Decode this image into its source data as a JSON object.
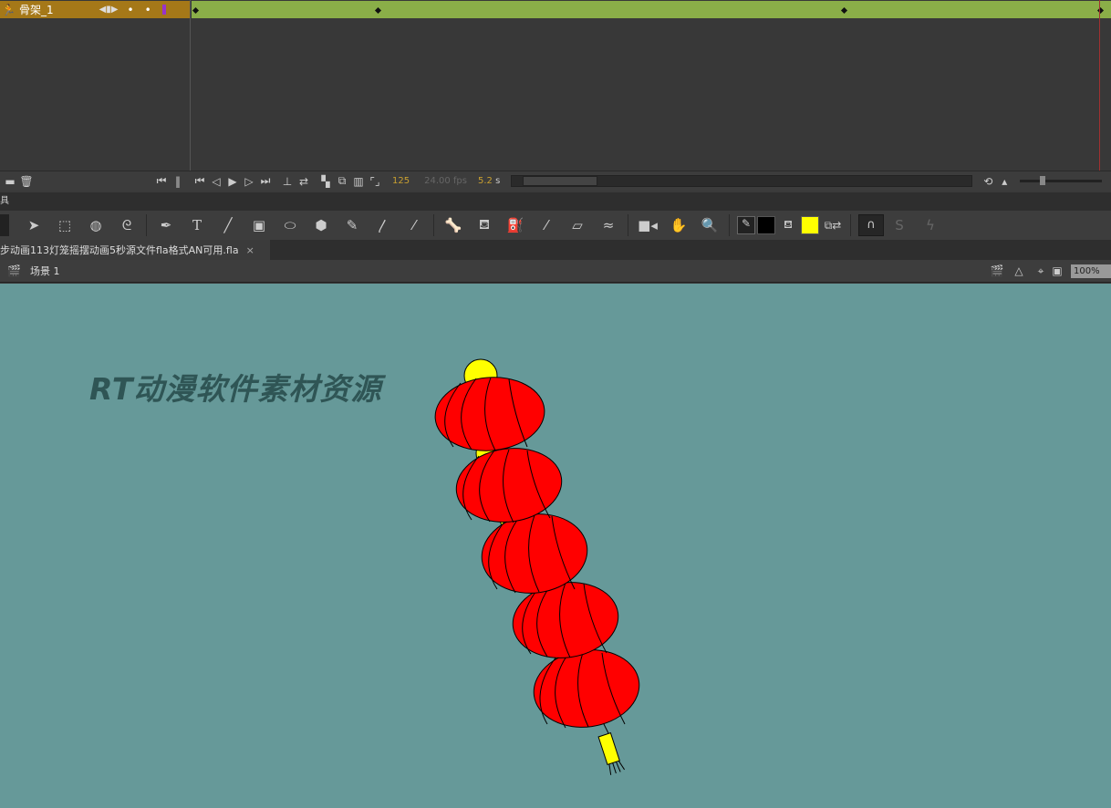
{
  "timeline": {
    "layer_name": "骨架_1",
    "current_frame": "125",
    "fps": "24.00 fps",
    "elapsed": "5.2",
    "elapsed_unit": "s",
    "layer_color": "#a57818",
    "span_color": "#8aae48",
    "layer_outline_color": "#9933cc"
  },
  "panel": {
    "label": "具"
  },
  "tools": [
    "selection-icon",
    "free-transform-icon",
    "3d-rotation-icon",
    "lasso-icon",
    "pen-icon",
    "text-icon",
    "line-icon",
    "rectangle-icon",
    "oval-icon",
    "polystar-icon",
    "pencil-icon",
    "paint-brush-icon",
    "brush-icon",
    "bone-icon",
    "paint-bucket-icon",
    "ink-bottle-icon",
    "eyedropper-icon",
    "eraser-icon",
    "width-icon",
    "camera-icon",
    "hand-icon",
    "zoom-icon"
  ],
  "text_tool_label": "T",
  "colors": {
    "stroke": "#000000",
    "fill": "#ffff00",
    "stage": "#669999"
  },
  "document": {
    "tab_title": "步动画113灯笼摇摆动画5秒源文件fla格式AN可用.fla",
    "close": "×"
  },
  "edit_bar": {
    "scene": "场景 1",
    "zoom": "100%"
  },
  "stage": {
    "watermark": "RT动漫软件素材资源"
  }
}
